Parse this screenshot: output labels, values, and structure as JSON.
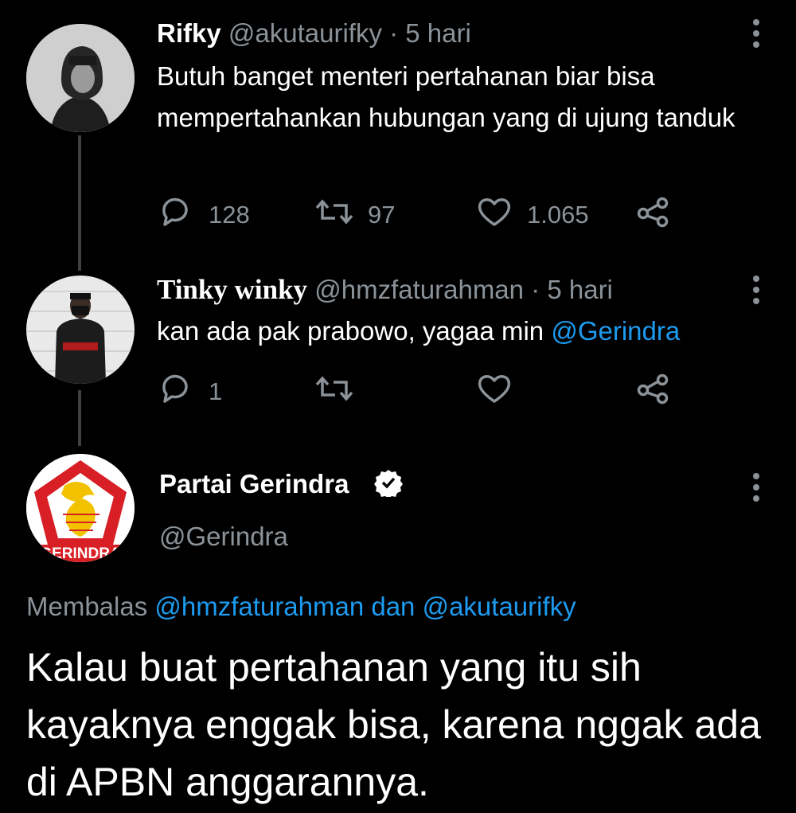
{
  "tweets": [
    {
      "name": "Rifky",
      "handle": "@akutaurifky",
      "time": "· 5 hari",
      "text": "Butuh banget menteri pertahanan biar bisa mempertahankan hubungan yang di ujung tanduk",
      "replies": "128",
      "retweets": "97",
      "likes": "1.065"
    },
    {
      "name": "Tinky winky",
      "handle": "@hmzfaturahman",
      "time": "· 5 hari",
      "text": "kan ada pak prabowo, yagaa min ",
      "mention": "@Gerindra",
      "replies": "1",
      "retweets": "",
      "likes": ""
    }
  ],
  "main_tweet": {
    "name": "Partai Gerindra",
    "handle": "@Gerindra",
    "logo_text": "GERINDRA",
    "replying_label": "Membalas ",
    "replying_to_1": "@hmzfaturahman",
    "replying_and": " dan ",
    "replying_to_2": "@akutaurifky",
    "text": "Kalau buat pertahanan yang itu sih kayaknya enggak bisa, karena nggak ada di APBN anggarannya."
  },
  "colors": {
    "background": "#000000",
    "text": "#ffffff",
    "muted": "#8b9298",
    "link": "#1d9bf0",
    "thread_line": "#3e4144",
    "gerindra_red": "#d81f26",
    "gerindra_gold": "#f2c200"
  },
  "icons": [
    "reply-icon",
    "retweet-icon",
    "like-icon",
    "share-icon",
    "more-icon",
    "verified-badge-icon"
  ]
}
